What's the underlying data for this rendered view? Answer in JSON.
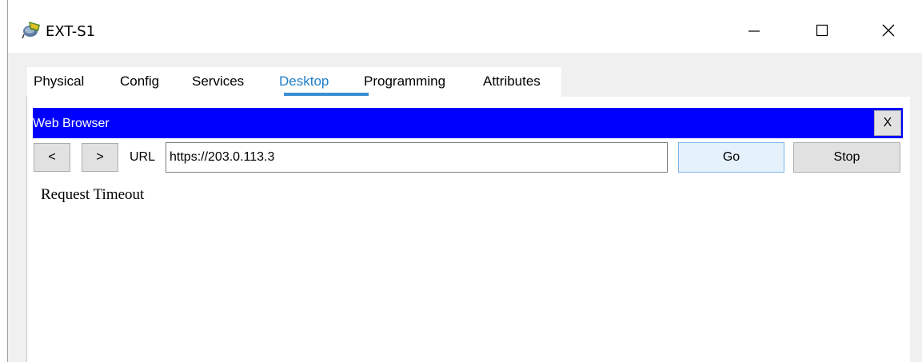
{
  "window": {
    "title": "EXT-S1",
    "app_icon": "packet-tracer-device-icon",
    "controls": {
      "minimize_icon": "minimize-icon",
      "maximize_icon": "maximize-icon",
      "close_icon": "close-icon"
    }
  },
  "tabs": [
    {
      "label": "Physical",
      "active": false
    },
    {
      "label": "Config",
      "active": false
    },
    {
      "label": "Services",
      "active": false
    },
    {
      "label": "Desktop",
      "active": true
    },
    {
      "label": "Programming",
      "active": false
    },
    {
      "label": "Attributes",
      "active": false
    }
  ],
  "browser": {
    "title": "Web Browser",
    "close_label": "X",
    "back_label": "<",
    "forward_label": ">",
    "url_label": "URL",
    "url_value": "https://203.0.113.3",
    "go_label": "Go",
    "stop_label": "Stop",
    "page_text": "Request Timeout"
  },
  "colors": {
    "browser_header": "#0000ff",
    "active_tab": "#1f7ec7",
    "go_button": "#e5f1fb"
  }
}
